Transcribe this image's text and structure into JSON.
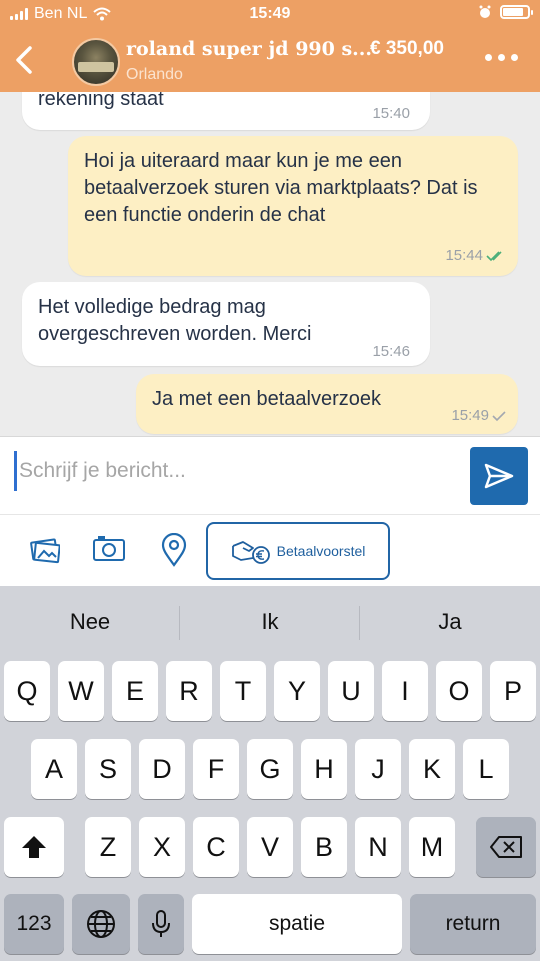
{
  "status": {
    "carrier": "Ben NL",
    "time": "15:49"
  },
  "header": {
    "title": "roland super jd 990 s...",
    "subtitle": "Orlando",
    "price": "€ 350,00"
  },
  "messages": [
    {
      "text": "rekening staat",
      "time": "15:40",
      "from": "them"
    },
    {
      "text": "Hoi ja uiteraard maar kun je me een betaalverzoek sturen via marktplaats? Dat is een functie onderin de chat",
      "time": "15:44",
      "from": "me",
      "status": "read"
    },
    {
      "text": "Het volledige bedrag mag overgeschreven worden. Merci",
      "time": "15:46",
      "from": "them"
    },
    {
      "text": "Ja met een betaalverzoek",
      "time": "15:49",
      "from": "me",
      "status": "delivered"
    }
  ],
  "compose": {
    "placeholder": "Schrijf je bericht..."
  },
  "actions": {
    "betaal_label": "Betaalvoorstel"
  },
  "keyboard": {
    "suggestions": [
      "Nee",
      "Ik",
      "Ja"
    ],
    "row1": [
      "Q",
      "W",
      "E",
      "R",
      "T",
      "Y",
      "U",
      "I",
      "O",
      "P"
    ],
    "row2": [
      "A",
      "S",
      "D",
      "F",
      "G",
      "H",
      "J",
      "K",
      "L"
    ],
    "row3": [
      "Z",
      "X",
      "C",
      "V",
      "B",
      "N",
      "M"
    ],
    "numbers_label": "123",
    "space_label": "spatie",
    "return_label": "return"
  },
  "colors": {
    "header": "#eda064",
    "incoming": "#ffffff",
    "outgoing": "#fdefc4",
    "accent": "#1f6aae",
    "read_tick": "#4caf7a"
  }
}
